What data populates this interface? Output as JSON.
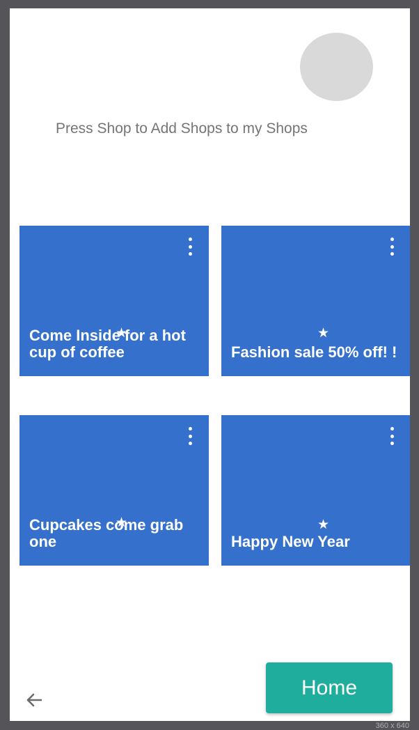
{
  "hint": "Press Shop to Add Shops to my Shops",
  "cards": [
    {
      "title": "Come Inside for a hot cup of coffee",
      "star_icon": "star-icon",
      "menu_icon": "more-vert-icon"
    },
    {
      "title": "Fashion sale 50% off! !",
      "star_icon": "star-icon",
      "menu_icon": "more-vert-icon"
    },
    {
      "title": "Cupcakes come grab one",
      "star_icon": "star-icon",
      "menu_icon": "more-vert-icon"
    },
    {
      "title": "Happy New Year",
      "star_icon": "star-icon",
      "menu_icon": "more-vert-icon"
    }
  ],
  "home_button": "Home",
  "back_icon": "arrow-left-icon",
  "screen_size_label": "360 x 640",
  "colors": {
    "card": "#3470cc",
    "home": "#1fae9d",
    "avatar": "#d9d9d9"
  }
}
